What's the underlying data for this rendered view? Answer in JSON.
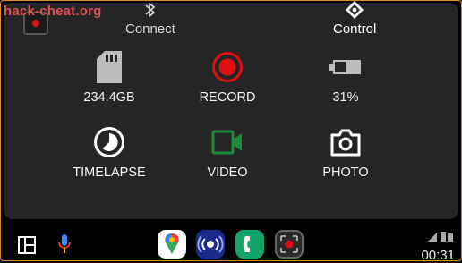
{
  "watermark": "hack-cheat.org",
  "header": {
    "connect_label": "Connect",
    "control_label": "Control"
  },
  "tiles": [
    {
      "label": "234.4GB",
      "icon": "sd-card-icon"
    },
    {
      "label": "RECORD",
      "icon": "record-icon"
    },
    {
      "label": "31%",
      "icon": "battery-icon"
    },
    {
      "label": "TIMELAPSE",
      "icon": "timelapse-icon"
    },
    {
      "label": "VIDEO",
      "icon": "videocam-icon"
    },
    {
      "label": "PHOTO",
      "icon": "camera-icon"
    }
  ],
  "taskbar": {
    "apps": [
      "google-maps-icon",
      "podcast-icon",
      "phone-app-icon",
      "dashcam-app-icon"
    ],
    "time": "00:31"
  },
  "colors": {
    "record": "#e01010",
    "video": "#1f8a3a",
    "frame_border": "#e38a2c"
  }
}
